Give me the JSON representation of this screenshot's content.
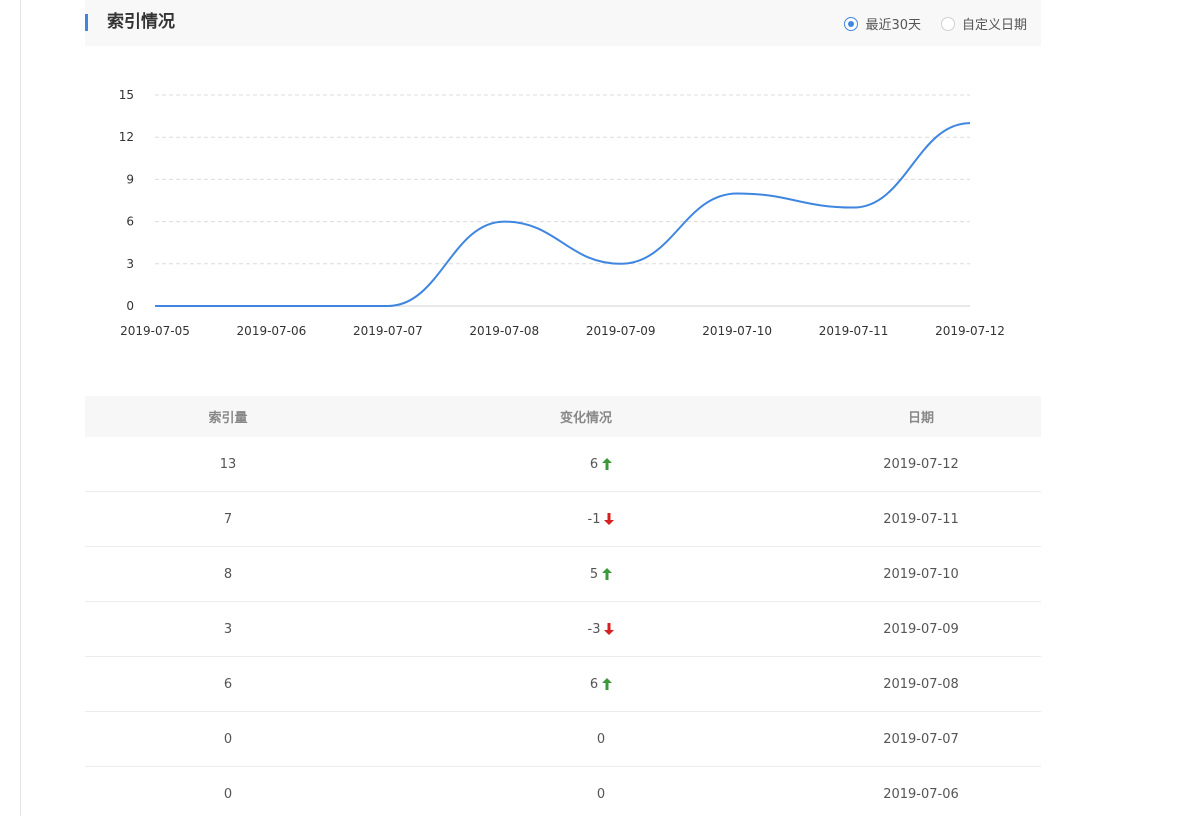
{
  "header": {
    "title": "索引情况",
    "range_options": [
      {
        "label": "最近30天",
        "checked": true
      },
      {
        "label": "自定义日期",
        "checked": false
      }
    ]
  },
  "colors": {
    "accent": "#3e86e0",
    "up": "#3a9a3a",
    "down": "#d61f1f"
  },
  "chart_data": {
    "type": "line",
    "x": [
      "2019-07-05",
      "2019-07-06",
      "2019-07-07",
      "2019-07-08",
      "2019-07-09",
      "2019-07-10",
      "2019-07-11",
      "2019-07-12"
    ],
    "series": [
      {
        "values": [
          0,
          0,
          0,
          6,
          3,
          8,
          7,
          13
        ]
      }
    ],
    "ylim": [
      0,
      15
    ],
    "yticks": [
      0,
      3,
      6,
      9,
      12,
      15
    ],
    "grid": true,
    "smooth": true
  },
  "table": {
    "headers": {
      "count": "索引量",
      "change": "变化情况",
      "date": "日期"
    },
    "rows": [
      {
        "count": "13",
        "change": "6",
        "dir": "up",
        "date": "2019-07-12"
      },
      {
        "count": "7",
        "change": "-1",
        "dir": "down",
        "date": "2019-07-11"
      },
      {
        "count": "8",
        "change": "5",
        "dir": "up",
        "date": "2019-07-10"
      },
      {
        "count": "3",
        "change": "-3",
        "dir": "down",
        "date": "2019-07-09"
      },
      {
        "count": "6",
        "change": "6",
        "dir": "up",
        "date": "2019-07-08"
      },
      {
        "count": "0",
        "change": "0",
        "dir": "none",
        "date": "2019-07-07"
      },
      {
        "count": "0",
        "change": "0",
        "dir": "none",
        "date": "2019-07-06"
      }
    ]
  }
}
